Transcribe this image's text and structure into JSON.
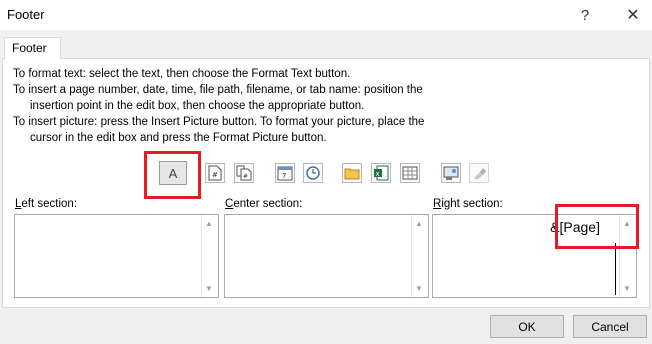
{
  "window": {
    "title": "Footer",
    "help_glyph": "?",
    "close_glyph": "✕"
  },
  "tabs": [
    {
      "label": "Footer"
    }
  ],
  "instructions": [
    "To format text:  select the text, then choose the Format Text button.",
    "To insert a page number, date, time, file path, filename, or tab name:  position the",
    "insertion point in the edit box, then choose the appropriate button.",
    "To insert picture: press the Insert Picture button.  To format your picture, place the",
    "cursor in the edit box and press the Format Picture button."
  ],
  "toolbar": {
    "format_text_label": "A",
    "buttons": [
      {
        "icon": "insert-page-number-icon"
      },
      {
        "icon": "insert-number-of-pages-icon"
      },
      {
        "icon": "insert-date-icon"
      },
      {
        "icon": "insert-time-icon"
      },
      {
        "icon": "insert-file-path-icon"
      },
      {
        "icon": "insert-file-name-icon"
      },
      {
        "icon": "insert-sheet-name-icon"
      },
      {
        "icon": "insert-picture-icon"
      },
      {
        "icon": "format-picture-icon"
      }
    ]
  },
  "sections": {
    "left": {
      "label_first": "L",
      "label_rest": "eft section:",
      "value": ""
    },
    "center": {
      "label_first": "C",
      "label_rest": "enter section:",
      "value": ""
    },
    "right": {
      "label_first": "R",
      "label_rest": "ight section:",
      "value": "&[Page]"
    }
  },
  "buttons": {
    "ok": "OK",
    "cancel": "Cancel"
  },
  "colors": {
    "highlight": "#e21b26",
    "dialog_bg": "#f0f0f0"
  }
}
